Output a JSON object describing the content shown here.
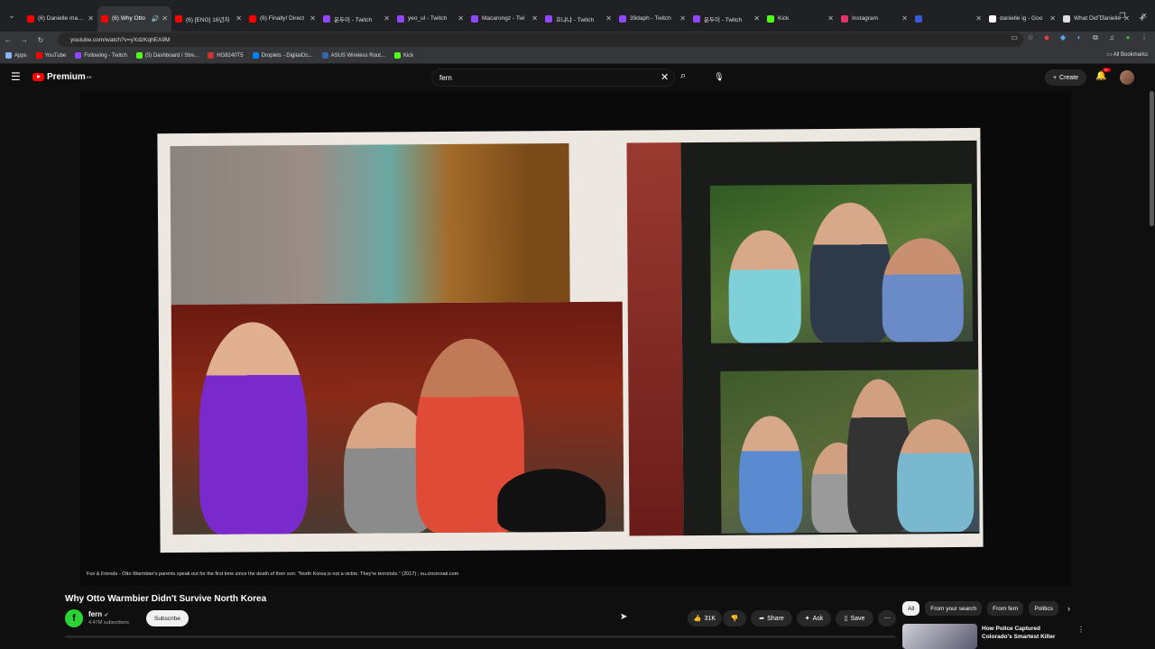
{
  "browser": {
    "tabs": [
      {
        "label": "(6) Danielle marsh",
        "color": "#ff0000",
        "active": false
      },
      {
        "label": "(6) Why Otto",
        "color": "#ff0000",
        "active": true,
        "audio": true
      },
      {
        "label": "(6) [ENG] 16년차",
        "color": "#ff0000",
        "active": false
      },
      {
        "label": "(6) Finally! Direct",
        "color": "#ff0000",
        "active": false
      },
      {
        "label": "윤두이 - Twitch",
        "color": "#9146ff",
        "active": false
      },
      {
        "label": "yeo_ul - Twitch",
        "color": "#9146ff",
        "active": false
      },
      {
        "label": "Macarongz - Twi",
        "color": "#9146ff",
        "active": false
      },
      {
        "label": "호냐냐 - Twitch",
        "color": "#9146ff",
        "active": false
      },
      {
        "label": "39daph - Twitch",
        "color": "#9146ff",
        "active": false
      },
      {
        "label": "윤두이 - Twitch",
        "color": "#9146ff",
        "active": false
      },
      {
        "label": "Kick",
        "color": "#53fc18",
        "active": false
      },
      {
        "label": "Instagram",
        "color": "#e1306c",
        "active": false
      },
      {
        "label": "",
        "color": "#3a5bd9",
        "active": false
      },
      {
        "label": "danielle ig - Goo",
        "color": "#ffffff",
        "active": false
      },
      {
        "label": "What Did Danielle",
        "color": "#dddddd",
        "active": false
      }
    ],
    "url": "youtube.com/watch?v=yXdzKqhEA9M",
    "bookmarks": [
      {
        "label": "Apps",
        "color": "#8ab4f8"
      },
      {
        "label": "YouTube",
        "color": "#ff0000"
      },
      {
        "label": "Following - Twitch",
        "color": "#9146ff"
      },
      {
        "label": "(5) Dashboard / Stre...",
        "color": "#53fc18"
      },
      {
        "label": "HG8240T5",
        "color": "#cc3333"
      },
      {
        "label": "Droplets - DigitalOc...",
        "color": "#0080ff"
      },
      {
        "label": "ASUS Wireless Rout...",
        "color": "#3366aa"
      },
      {
        "label": "Kick",
        "color": "#53fc18"
      }
    ],
    "all_bookmarks": "All Bookmarks"
  },
  "youtube": {
    "logo_text": "Premium",
    "logo_sup": "KR",
    "search_value": "fern",
    "create_label": "Create",
    "notif_count": "9+"
  },
  "video": {
    "caption": "Fox & Friends - Otto Warmbier's parents speak out for the first time since the death of their son: \"North Korea is not a victim. They're terrorists.\" (2017) ; eu.cincinnati.com",
    "title": "Why Otto Warmbier Didn't Survive North Korea",
    "channel": "fern",
    "channel_initial": "f",
    "subscribers": "4.47M subscribers",
    "subscribe_label": "Subscribe",
    "likes": "31K",
    "share_label": "Share",
    "ask_label": "Ask",
    "save_label": "Save"
  },
  "chips": [
    "All",
    "From your search",
    "From fern",
    "Politics"
  ],
  "recommendation": {
    "title": "How Police Captured Colorado's Smartest Killer"
  }
}
